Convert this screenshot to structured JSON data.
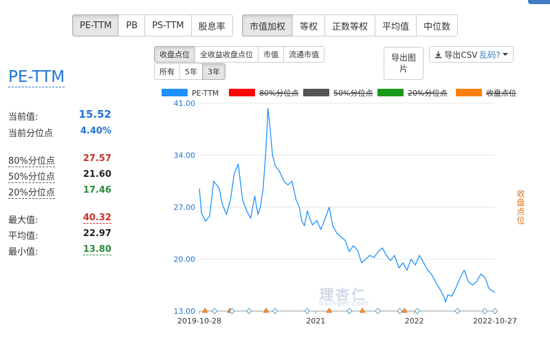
{
  "toolbar": {
    "metric_tabs": [
      "PE-TTM",
      "PB",
      "PS-TTM",
      "股息率"
    ],
    "weight_tabs": [
      "市值加权",
      "等权",
      "正数等权",
      "平均值",
      "中位数"
    ],
    "series_tabs": [
      "收盘点位",
      "全收益收盘点位",
      "市值",
      "流通市值"
    ],
    "range_tabs": [
      "所有",
      "5年",
      "3年"
    ],
    "export_image": "导出图片",
    "export_csv": "导出CSV",
    "garbled_link": "乱码?"
  },
  "stats": {
    "title": "PE-TTM",
    "current_label": "当前值:",
    "current_value": "15.52",
    "current_pct_label": "当前分位点",
    "current_pct_value": "4.40%",
    "p80_label": "80%分位点",
    "p80_value": "27.57",
    "p50_label": "50%分位点",
    "p50_value": "21.60",
    "p20_label": "20%分位点",
    "p20_value": "17.46",
    "max_label": "最大值:",
    "max_value": "40.32",
    "avg_label": "平均值:",
    "avg_value": "22.97",
    "min_label": "最小值:",
    "min_value": "13.80"
  },
  "colors": {
    "blue": "#1e73d6",
    "red": "#c9302c",
    "green": "#2e8b3a",
    "black": "#222222",
    "orange": "#e47012",
    "series": "#1e90ff"
  },
  "watermark": {
    "cn": "理杏仁",
    "en": "lixinger.com"
  },
  "right_axis_label": "收盘点位",
  "chart_data": {
    "type": "line",
    "legend": [
      "PE-TTM",
      "80%分位点",
      "50%分位点",
      "20%分位点",
      "收盘点位"
    ],
    "legend_disabled": [
      false,
      true,
      true,
      true,
      true
    ],
    "legend_colors": [
      "#1e90ff",
      "#ff0000",
      "#555555",
      "#1a9a1a",
      "#ff7f0e"
    ],
    "y_ticks": [
      "41.00",
      "34.00",
      "27.00",
      "20.00",
      "13.00"
    ],
    "x_ticks": [
      "2019-10-28",
      "2021",
      "2022",
      "2022-10-27"
    ],
    "ylim": [
      13,
      41
    ],
    "x_range": [
      "2019-10-28",
      "2022-10-27"
    ],
    "series": [
      {
        "name": "PE-TTM",
        "x": [
          "2019-10-28",
          "2019-11-05",
          "2019-11-20",
          "2019-12-05",
          "2019-12-20",
          "2020-01-10",
          "2020-01-20",
          "2020-02-05",
          "2020-02-20",
          "2020-03-05",
          "2020-03-20",
          "2020-04-05",
          "2020-04-20",
          "2020-05-05",
          "2020-05-20",
          "2020-06-01",
          "2020-06-10",
          "2020-06-20",
          "2020-07-01",
          "2020-07-08",
          "2020-07-15",
          "2020-07-25",
          "2020-08-05",
          "2020-08-20",
          "2020-09-05",
          "2020-09-20",
          "2020-10-05",
          "2020-10-20",
          "2020-11-01",
          "2020-11-10",
          "2020-11-20",
          "2020-12-01",
          "2020-12-10",
          "2020-12-20",
          "2021-01-05",
          "2021-01-20",
          "2021-02-05",
          "2021-02-20",
          "2021-03-05",
          "2021-03-20",
          "2021-04-05",
          "2021-04-20",
          "2021-05-05",
          "2021-05-20",
          "2021-06-05",
          "2021-06-20",
          "2021-07-05",
          "2021-07-20",
          "2021-08-05",
          "2021-08-20",
          "2021-09-05",
          "2021-09-20",
          "2021-10-05",
          "2021-10-20",
          "2021-11-05",
          "2021-11-20",
          "2021-12-05",
          "2021-12-20",
          "2022-01-05",
          "2022-01-20",
          "2022-02-05",
          "2022-02-20",
          "2022-03-05",
          "2022-03-20",
          "2022-04-05",
          "2022-04-20",
          "2022-04-27",
          "2022-05-05",
          "2022-05-20",
          "2022-06-05",
          "2022-06-20",
          "2022-07-05",
          "2022-07-20",
          "2022-08-05",
          "2022-08-20",
          "2022-09-05",
          "2022-09-20",
          "2022-10-05",
          "2022-10-27"
        ],
        "values": [
          29.5,
          26.2,
          25.1,
          25.8,
          30.5,
          29.5,
          27.5,
          26.0,
          28.0,
          31.5,
          32.8,
          28.0,
          26.5,
          25.5,
          28.5,
          26.0,
          27.0,
          29.5,
          35.0,
          40.3,
          38.0,
          34.0,
          32.5,
          31.8,
          30.5,
          30.0,
          30.5,
          28.0,
          27.0,
          25.2,
          24.5,
          26.5,
          25.5,
          24.6,
          25.2,
          24.0,
          25.5,
          27.0,
          24.5,
          23.5,
          23.0,
          22.5,
          21.0,
          21.8,
          21.2,
          19.5,
          20.0,
          20.5,
          20.2,
          21.0,
          21.5,
          20.5,
          19.8,
          20.5,
          18.8,
          19.5,
          18.5,
          20.0,
          19.2,
          20.5,
          19.5,
          18.5,
          18.0,
          17.0,
          16.0,
          15.0,
          14.2,
          15.2,
          15.0,
          16.2,
          17.5,
          18.5,
          17.0,
          16.5,
          17.0,
          18.0,
          17.5,
          16.0,
          15.5
        ]
      }
    ],
    "markers_orange": [
      "2019-11-18",
      "2020-02-18",
      "2020-07-01",
      "2021-02-20",
      "2021-06-23",
      "2021-11-26"
    ],
    "markers_blue": [
      "2019-12-23",
      "2020-02-26",
      "2020-04-29",
      "2020-08-03",
      "2020-11-30",
      "2021-05-06",
      "2021-08-19",
      "2021-11-08",
      "2022-01-12",
      "2022-06-10",
      "2022-09-19",
      "2022-10-27"
    ]
  }
}
